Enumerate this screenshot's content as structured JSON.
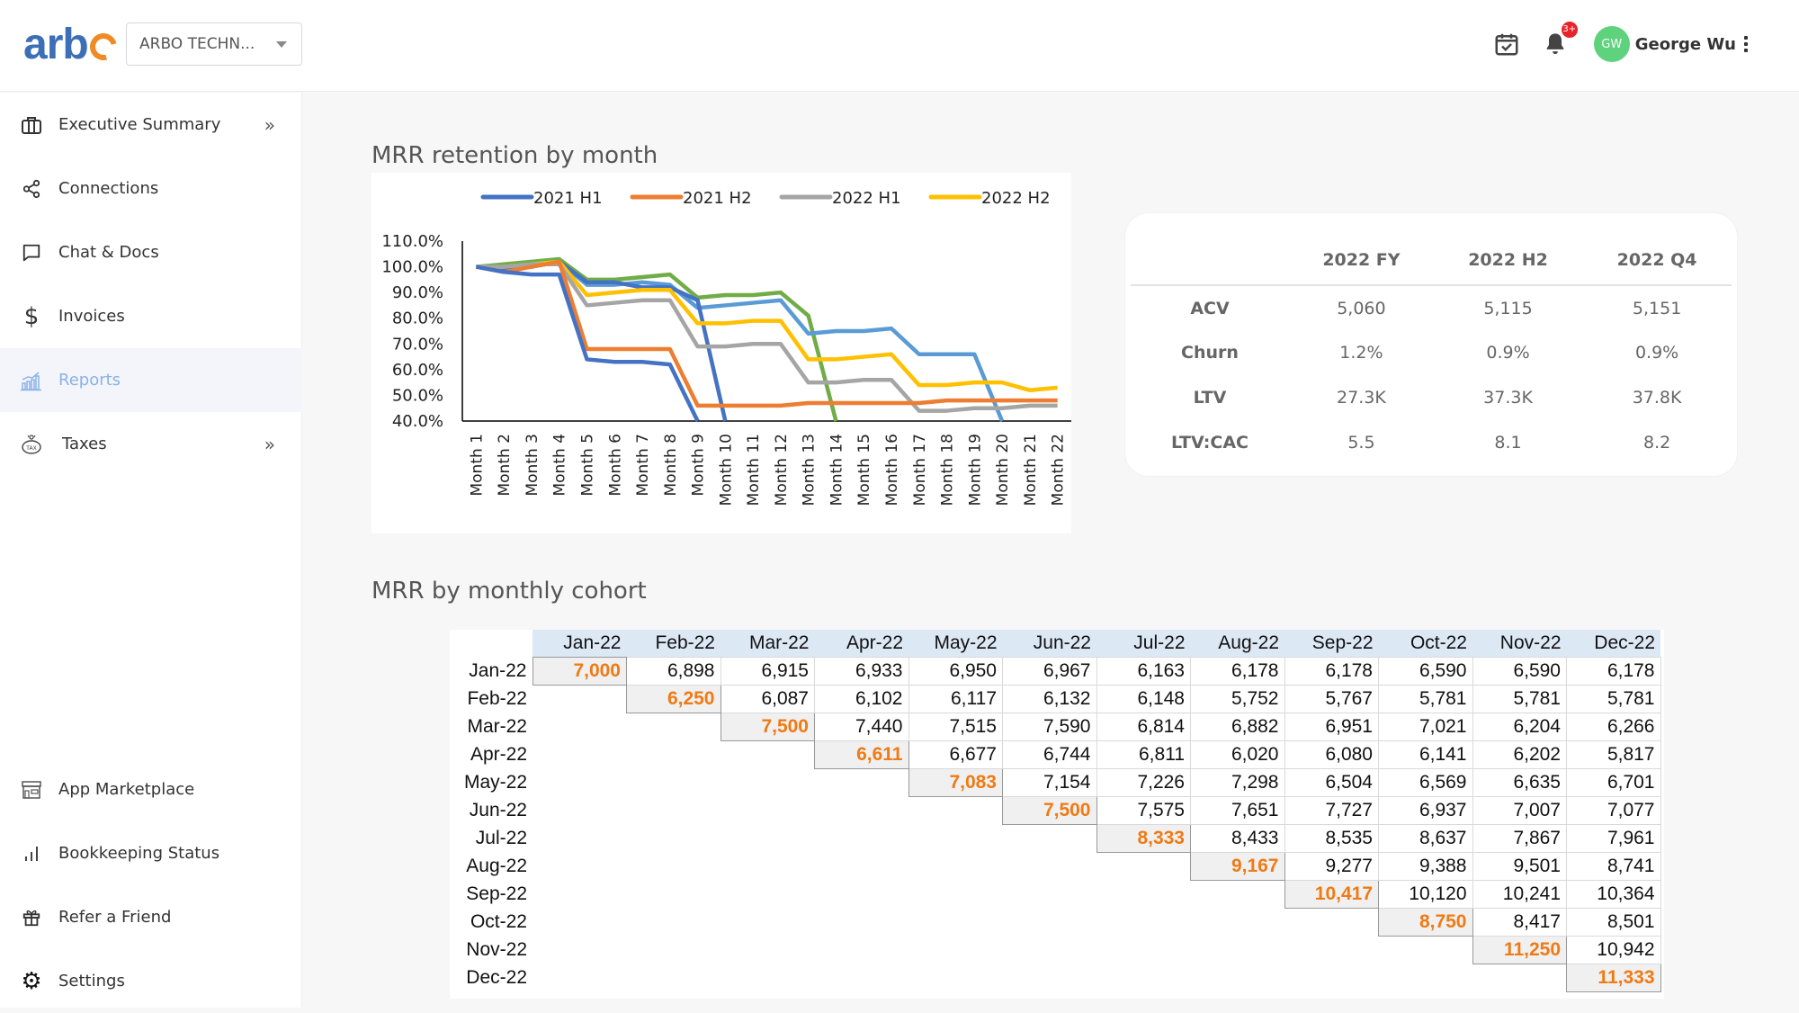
{
  "header": {
    "logo_text": "arb",
    "company_select": "ARBO TECHN...",
    "notification_badge": "3+",
    "avatar_initials": "GW",
    "user_name": "George Wu"
  },
  "sidebar": {
    "items": [
      {
        "label": "Executive Summary",
        "icon": "briefcase-icon",
        "expandable": true
      },
      {
        "label": "Connections",
        "icon": "share-icon",
        "expandable": false
      },
      {
        "label": "Chat & Docs",
        "icon": "chat-icon",
        "expandable": false
      },
      {
        "label": "Invoices",
        "icon": "dollar-icon",
        "expandable": false
      },
      {
        "label": "Reports",
        "icon": "chart-icon",
        "expandable": false,
        "active": true
      },
      {
        "label": "Taxes",
        "icon": "tax-piggy-icon",
        "expandable": true
      }
    ],
    "bottom_items": [
      {
        "label": "App Marketplace",
        "icon": "store-icon"
      },
      {
        "label": "Bookkeeping Status",
        "icon": "bar-signal-icon"
      },
      {
        "label": "Refer a Friend",
        "icon": "gift-icon"
      },
      {
        "label": "Settings",
        "icon": "gear-icon"
      }
    ]
  },
  "main": {
    "retention_title": "MRR retention by month",
    "cohort_title": "MRR by monthly cohort"
  },
  "metrics": {
    "columns": [
      "",
      "2022 FY",
      "2022 H2",
      "2022 Q4"
    ],
    "rows": [
      {
        "label": "ACV",
        "values": [
          "5,060",
          "5,115",
          "5,151"
        ]
      },
      {
        "label": "Churn",
        "values": [
          "1.2%",
          "0.9%",
          "0.9%"
        ]
      },
      {
        "label": "LTV",
        "values": [
          "27.3K",
          "37.3K",
          "37.8K"
        ]
      },
      {
        "label": "LTV:CAC",
        "values": [
          "5.5",
          "8.1",
          "8.2"
        ]
      }
    ]
  },
  "cohort": {
    "columns": [
      "Jan-22",
      "Feb-22",
      "Mar-22",
      "Apr-22",
      "May-22",
      "Jun-22",
      "Jul-22",
      "Aug-22",
      "Sep-22",
      "Oct-22",
      "Nov-22",
      "Dec-22"
    ],
    "rows": [
      {
        "label": "Jan-22",
        "start": 0,
        "values": [
          "7,000",
          "6,898",
          "6,915",
          "6,933",
          "6,950",
          "6,967",
          "6,163",
          "6,178",
          "6,178",
          "6,590",
          "6,590",
          "6,178"
        ]
      },
      {
        "label": "Feb-22",
        "start": 1,
        "values": [
          "6,250",
          "6,087",
          "6,102",
          "6,117",
          "6,132",
          "6,148",
          "5,752",
          "5,767",
          "5,781",
          "5,781",
          "5,781"
        ]
      },
      {
        "label": "Mar-22",
        "start": 2,
        "values": [
          "7,500",
          "7,440",
          "7,515",
          "7,590",
          "6,814",
          "6,882",
          "6,951",
          "7,021",
          "6,204",
          "6,266"
        ]
      },
      {
        "label": "Apr-22",
        "start": 3,
        "values": [
          "6,611",
          "6,677",
          "6,744",
          "6,811",
          "6,020",
          "6,080",
          "6,141",
          "6,202",
          "5,817"
        ]
      },
      {
        "label": "May-22",
        "start": 4,
        "values": [
          "7,083",
          "7,154",
          "7,226",
          "7,298",
          "6,504",
          "6,569",
          "6,635",
          "6,701"
        ]
      },
      {
        "label": "Jun-22",
        "start": 5,
        "values": [
          "7,500",
          "7,575",
          "7,651",
          "7,727",
          "6,937",
          "7,007",
          "7,077"
        ]
      },
      {
        "label": "Jul-22",
        "start": 6,
        "values": [
          "8,333",
          "8,433",
          "8,535",
          "8,637",
          "7,867",
          "7,961"
        ]
      },
      {
        "label": "Aug-22",
        "start": 7,
        "values": [
          "9,167",
          "9,277",
          "9,388",
          "9,501",
          "8,741"
        ]
      },
      {
        "label": "Sep-22",
        "start": 8,
        "values": [
          "10,417",
          "10,120",
          "10,241",
          "10,364"
        ]
      },
      {
        "label": "Oct-22",
        "start": 9,
        "values": [
          "8,750",
          "8,417",
          "8,501"
        ]
      },
      {
        "label": "Nov-22",
        "start": 10,
        "values": [
          "11,250",
          "10,942"
        ]
      },
      {
        "label": "Dec-22",
        "start": 11,
        "values": [
          "11,333"
        ]
      }
    ]
  },
  "chart_data": {
    "type": "line",
    "title": "MRR retention by month",
    "xlabel": "",
    "ylabel": "",
    "x": [
      "Month 1",
      "Month 2",
      "Month 3",
      "Month 4",
      "Month 5",
      "Month 6",
      "Month 7",
      "Month 8",
      "Month 9",
      "Month 10",
      "Month 11",
      "Month 12",
      "Month 13",
      "Month 14",
      "Month 15",
      "Month 16",
      "Month 17",
      "Month 18",
      "Month 19",
      "Month 20",
      "Month 21",
      "Month 22"
    ],
    "yticks": [
      "40.0%",
      "50.0%",
      "60.0%",
      "70.0%",
      "80.0%",
      "90.0%",
      "100.0%",
      "110.0%"
    ],
    "ylim": [
      0.4,
      1.1
    ],
    "legend_position": "top",
    "grid": false,
    "series": [
      {
        "name": "2021 H1",
        "color": "#4472c4",
        "values": [
          1.0,
          0.98,
          0.97,
          0.97,
          0.64,
          0.63,
          0.63,
          0.62,
          0.4
        ]
      },
      {
        "name": "2021 H2",
        "color": "#ed7d31",
        "values": [
          1.0,
          0.98,
          1.0,
          1.02,
          0.68,
          0.68,
          0.68,
          0.68,
          0.46,
          0.46,
          0.46,
          0.46,
          0.47,
          0.47,
          0.47,
          0.47,
          0.47,
          0.48,
          0.48,
          0.48,
          0.48,
          0.48
        ]
      },
      {
        "name": "2022 H1",
        "color": "#a5a5a5",
        "values": [
          1.0,
          1.0,
          1.01,
          1.01,
          0.85,
          0.86,
          0.87,
          0.87,
          0.69,
          0.69,
          0.7,
          0.7,
          0.55,
          0.55,
          0.56,
          0.56,
          0.44,
          0.44,
          0.45,
          0.45,
          0.46,
          0.46
        ]
      },
      {
        "name": "2022 H2",
        "color": "#ffc000",
        "values": [
          1.0,
          1.0,
          1.01,
          1.02,
          0.89,
          0.9,
          0.91,
          0.91,
          0.78,
          0.78,
          0.79,
          0.79,
          0.64,
          0.64,
          0.65,
          0.66,
          0.54,
          0.54,
          0.55,
          0.55,
          0.52,
          0.53
        ]
      },
      {
        "name": "",
        "color": "#5b9bd5",
        "values": [
          1.0,
          1.0,
          1.01,
          1.02,
          0.93,
          0.93,
          0.94,
          0.93,
          0.84,
          0.85,
          0.86,
          0.87,
          0.74,
          0.75,
          0.75,
          0.76,
          0.66,
          0.66,
          0.66,
          0.4
        ]
      },
      {
        "name": "",
        "color": "#70ad47",
        "values": [
          1.0,
          1.01,
          1.02,
          1.03,
          0.95,
          0.95,
          0.96,
          0.97,
          0.88,
          0.89,
          0.89,
          0.9,
          0.81,
          0.4
        ]
      },
      {
        "name": "",
        "color": "#4472c4",
        "values": [
          1.0,
          0.99,
          1.0,
          1.02,
          0.94,
          0.94,
          0.92,
          0.92,
          0.87,
          0.4
        ]
      }
    ]
  }
}
